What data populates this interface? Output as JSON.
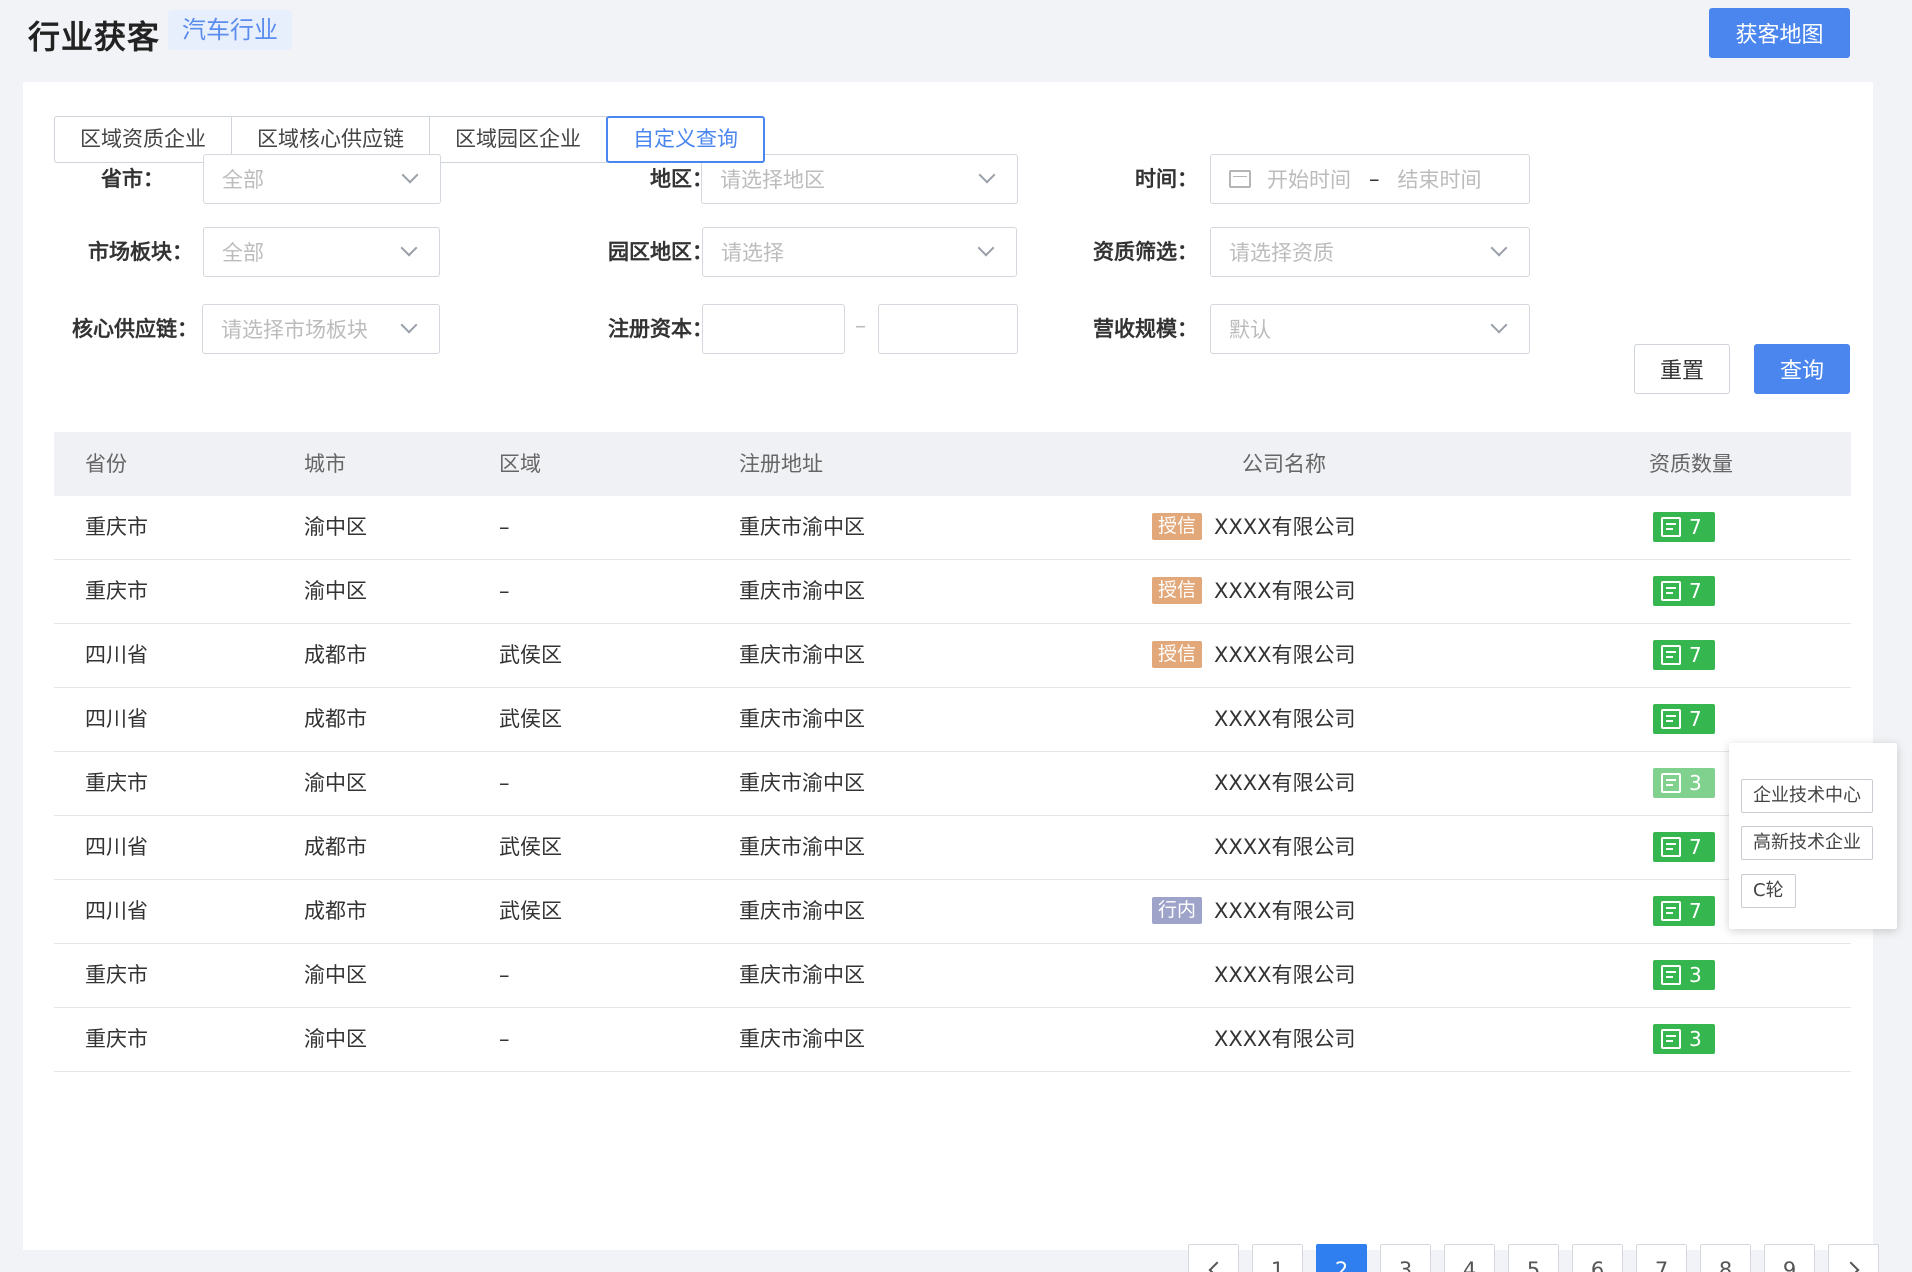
{
  "header": {
    "title": "行业获客",
    "industry_tag": "汽车行业",
    "map_button": "获客地图"
  },
  "tabs": [
    "区域资质企业",
    "区域核心供应链",
    "区域园区企业",
    "自定义查询"
  ],
  "active_tab": "自定义查询",
  "filters": {
    "province": {
      "label": "省市：",
      "value": "全部"
    },
    "region": {
      "label": "地区：",
      "placeholder": "请选择地区"
    },
    "time": {
      "label": "时间：",
      "start": "开始时间",
      "sep": "–",
      "end": "结束时间"
    },
    "market": {
      "label": "市场板块：",
      "value": "全部"
    },
    "park": {
      "label": "园区地区：",
      "placeholder": "请选择"
    },
    "qualification": {
      "label": "资质筛选：",
      "placeholder": "请选择资质"
    },
    "supply_chain": {
      "label": "核心供应链：",
      "placeholder": "请选择市场板块"
    },
    "capital": {
      "label": "注册资本：",
      "sep": "–"
    },
    "revenue": {
      "label": "营收规模：",
      "value": "默认"
    },
    "reset_button": "重置",
    "query_button": "查询"
  },
  "table": {
    "headers": [
      "省份",
      "城市",
      "区域",
      "注册地址",
      "公司名称",
      "资质数量"
    ],
    "rows": [
      {
        "province": "重庆市",
        "city": "渝中区",
        "area": "–",
        "address": "重庆市渝中区",
        "tag": "授信",
        "company": "XXXX有限公司",
        "qual": "7"
      },
      {
        "province": "重庆市",
        "city": "渝中区",
        "area": "–",
        "address": "重庆市渝中区",
        "tag": "授信",
        "company": "XXXX有限公司",
        "qual": "7"
      },
      {
        "province": "四川省",
        "city": "成都市",
        "area": "武侯区",
        "address": "重庆市渝中区",
        "tag": "授信",
        "company": "XXXX有限公司",
        "qual": "7"
      },
      {
        "province": "四川省",
        "city": "成都市",
        "area": "武侯区",
        "address": "重庆市渝中区",
        "tag": "",
        "company": "XXXX有限公司",
        "qual": "7"
      },
      {
        "province": "重庆市",
        "city": "渝中区",
        "area": "–",
        "address": "重庆市渝中区",
        "tag": "",
        "company": "XXXX有限公司",
        "qual": "3"
      },
      {
        "province": "四川省",
        "city": "成都市",
        "area": "武侯区",
        "address": "重庆市渝中区",
        "tag": "",
        "company": "XXXX有限公司",
        "qual": "7"
      },
      {
        "province": "四川省",
        "city": "成都市",
        "area": "武侯区",
        "address": "重庆市渝中区",
        "tag": "行内",
        "company": "XXXX有限公司",
        "qual": "7"
      },
      {
        "province": "重庆市",
        "city": "渝中区",
        "area": "–",
        "address": "重庆市渝中区",
        "tag": "",
        "company": "XXXX有限公司",
        "qual": "3"
      },
      {
        "province": "重庆市",
        "city": "渝中区",
        "area": "–",
        "address": "重庆市渝中区",
        "tag": "",
        "company": "XXXX有限公司",
        "qual": "3"
      }
    ]
  },
  "popover": {
    "items": [
      "企业技术中心",
      "高新技术企业",
      "C轮"
    ]
  },
  "pagination": {
    "pages": [
      "1",
      "2",
      "3",
      "4",
      "5",
      "6",
      "7",
      "8",
      "9"
    ],
    "current": "2"
  },
  "colors": {
    "primary": "#4b86ef",
    "badge_green": "#36b64f",
    "credit_tag": "#e2a87a",
    "inner_tag": "#9ea3c9"
  }
}
